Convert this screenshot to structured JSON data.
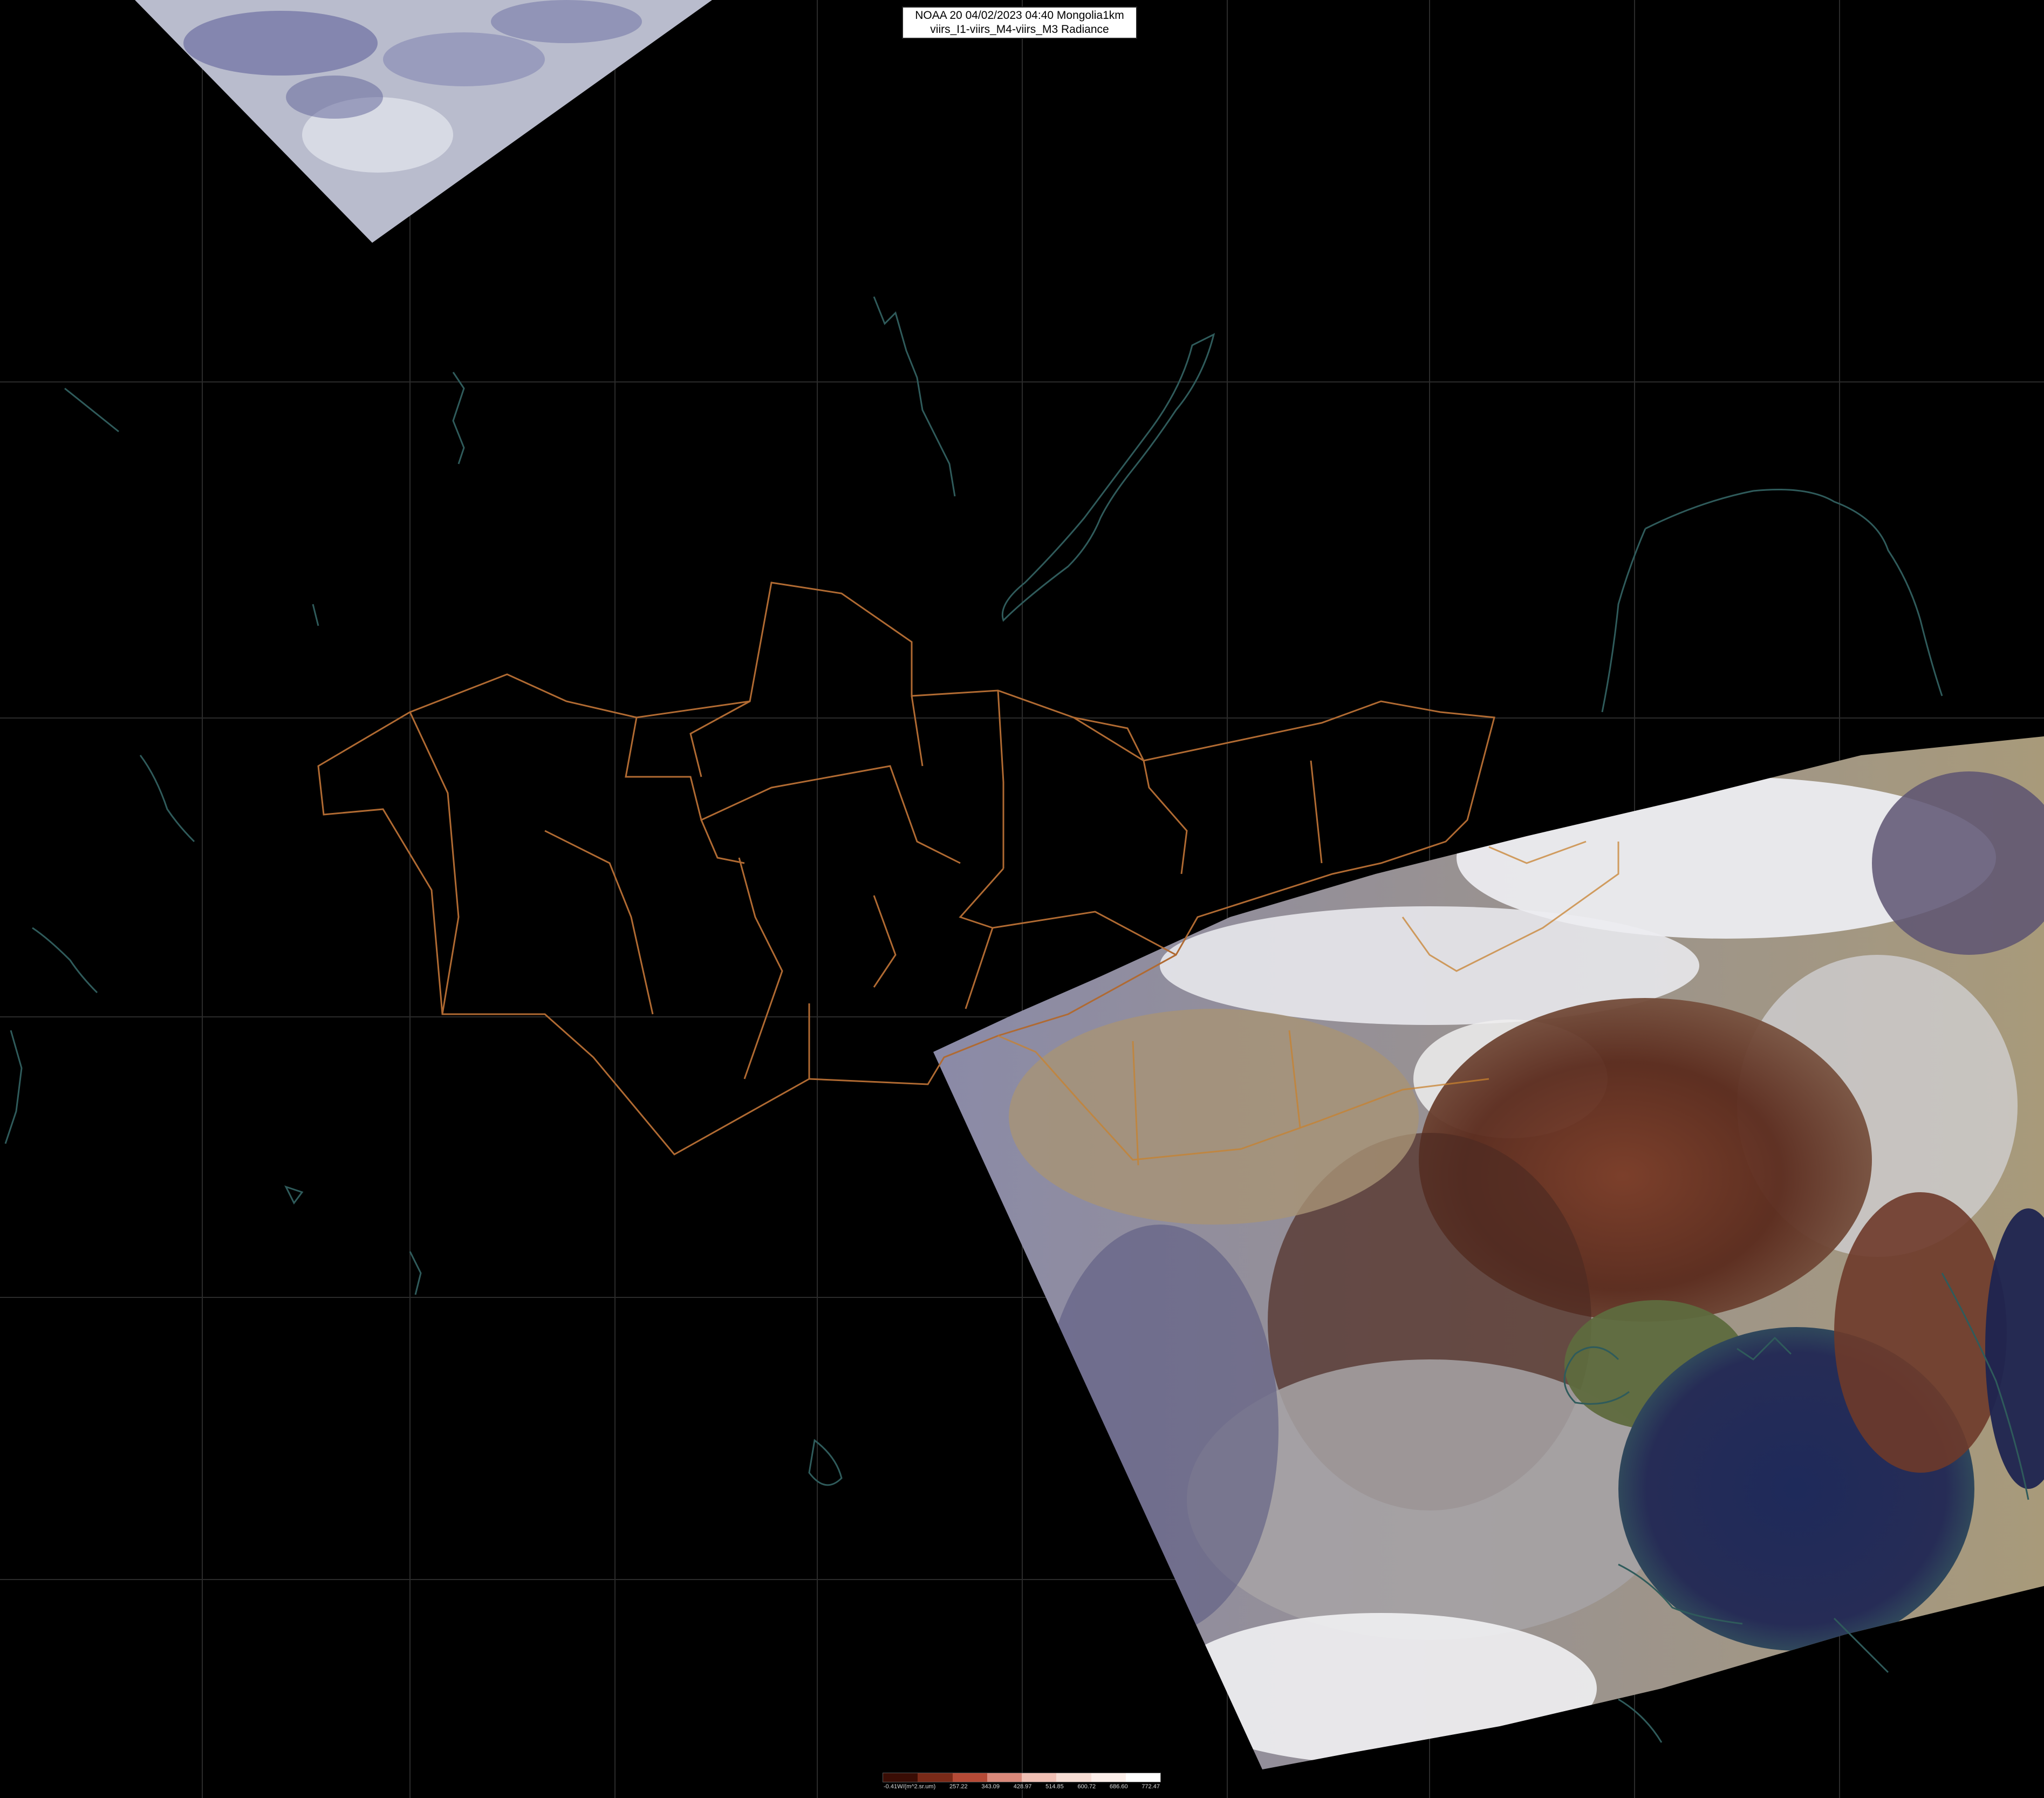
{
  "title": {
    "line1": "NOAA 20 04/02/2023 04:40 Mongolia1km",
    "line2": "viirs_I1-viirs_M4-viirs_M3 Radiance"
  },
  "legend": {
    "ticks": [
      "-0.41W/(m^2.sr.um)",
      "257.22",
      "343.09",
      "428.97",
      "514.85",
      "600.72",
      "686.60",
      "772.47"
    ],
    "colors": [
      "#3a0d05",
      "#7a2a18",
      "#b54a36",
      "#d9897a",
      "#f0bfb3",
      "#f6dcd4",
      "#fbeee9",
      "#ffffff"
    ]
  },
  "colors": {
    "background": "#000000",
    "graticule": "#2b2b2b",
    "admin_borders": "#b06a32",
    "coastlines": "#2f5b5b"
  }
}
